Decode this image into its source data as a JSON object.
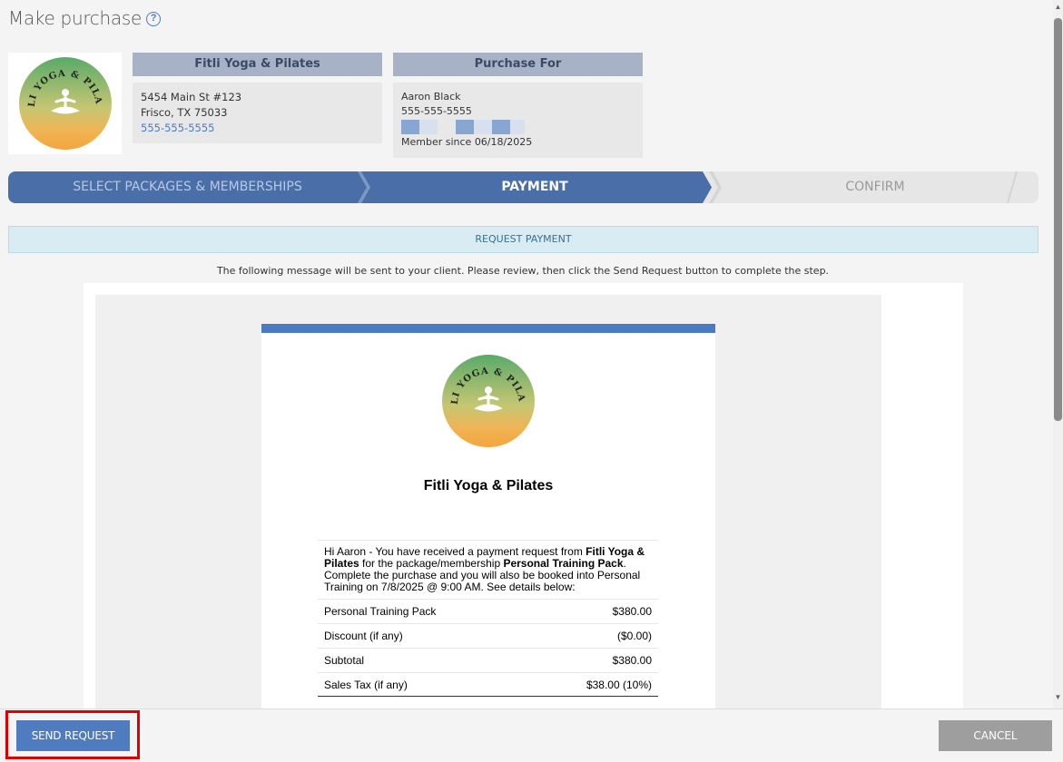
{
  "page": {
    "title": "Make purchase",
    "help_icon": "question-circle-icon"
  },
  "studio": {
    "logo_text": "FITLI YOGA & PILATES",
    "name": "Fitli Yoga & Pilates",
    "address1": "5454 Main St #123",
    "address2": "Frisco, TX 75033",
    "phone": "555-555-5555"
  },
  "purchase_for": {
    "heading": "Purchase For",
    "name": "Aaron Black",
    "phone": "555-555-5555",
    "member_since": "Member since 06/18/2025"
  },
  "steps": [
    {
      "label": "SELECT PACKAGES & MEMBERSHIPS",
      "state": "completed"
    },
    {
      "label": "PAYMENT",
      "state": "active"
    },
    {
      "label": "CONFIRM",
      "state": "pending"
    }
  ],
  "banner": {
    "label": "REQUEST PAYMENT"
  },
  "instruction": "The following message will be sent to your client.  Please review, then click the Send Request  button to complete the step.",
  "email": {
    "studio_name": "Fitli Yoga & Pilates",
    "msg_part1": "Hi Aaron - You have received a payment request from ",
    "msg_studio": "Fitli Yoga & Pilates",
    "msg_part2": " for the package/membership ",
    "msg_package": "Personal Training Pack",
    "msg_part3": ". Complete the purchase and you will also be booked into Personal Training on 7/8/2025 @ 9:00 AM. See details below:",
    "rows": [
      {
        "label": "Personal Training Pack",
        "value": "$380.00"
      },
      {
        "label": "Discount (if any)",
        "value": "($0.00)"
      },
      {
        "label": "Subtotal",
        "value": "$380.00"
      },
      {
        "label": "Sales Tax (if any)",
        "value": "$38.00 (10%)"
      }
    ]
  },
  "footer": {
    "send_label": "SEND REQUEST",
    "cancel_label": "CANCEL"
  },
  "colors": {
    "accent": "#4a7bc0",
    "step_active": "#4a6ea8",
    "highlight": "#e00000"
  }
}
